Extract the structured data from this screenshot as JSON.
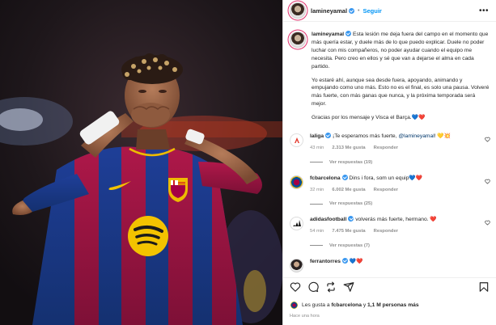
{
  "post": {
    "username": "lamineyamal",
    "follow_label": "Seguir",
    "more_label": "•••",
    "caption": {
      "username": "lamineyamal",
      "paragraph1": "Esta lesión me deja fuera del campo en el momento que más quería estar, y duele más de lo que puedo explicar. Duele no poder luchar con mis compañeros, no poder ayudar cuando el equipo me necesita. Pero creo en ellos y sé que van a dejarse el alma en cada partido.",
      "paragraph2": "Yo estaré ahí, aunque sea desde fuera, apoyando, animando y empujando como uno más. Esto no es el final, es solo una pausa. Volveré más fuerte, con más ganas que nunca, y la próxima temporada será mejor.",
      "paragraph3": "Gracias por los mensaje y Visca el Barça.💙❤️"
    },
    "comments": [
      {
        "user": "laliga",
        "text": "¡Te esperamos más fuerte,",
        "mention": "@lamineyamal",
        "text_after": "! 💛💥",
        "time": "43 min",
        "likes": "2.313 Me gusta",
        "reply": "Responder",
        "view_replies": "Ver respuestas (19)",
        "avatar": "laliga"
      },
      {
        "user": "fcbarcelona",
        "text": "Dins i fora, som un equip💙❤️",
        "mention": "",
        "text_after": "",
        "time": "32 min",
        "likes": "6.002 Me gusta",
        "reply": "Responder",
        "view_replies": "Ver respuestas (25)",
        "avatar": "fcb"
      },
      {
        "user": "adidasfootball",
        "text": "volverás más fuerte, hermano. ❤️",
        "mention": "",
        "text_after": "",
        "time": "54 min",
        "likes": "7.475 Me gusta",
        "reply": "Responder",
        "view_replies": "Ver respuestas (7)",
        "avatar": "adidas"
      },
      {
        "user": "ferrantorres",
        "text": "💙❤️",
        "mention": "",
        "text_after": "",
        "time": "",
        "likes": "",
        "reply": "",
        "view_replies": "",
        "avatar": "ferran"
      }
    ],
    "likes_text": "Les gusta a fcbarcelona y 1,1 M personas más",
    "likes_user": "fcbarcelona",
    "likes_count": "1,1 M personas más",
    "time_ago": "Hace una hora"
  },
  "photo": {
    "sponsor_brand": "spotify-logo",
    "colors": {
      "blue": "#1a3d8f",
      "red": "#a3153f",
      "yellow": "#f3c300"
    }
  },
  "accent": "#0095f6"
}
